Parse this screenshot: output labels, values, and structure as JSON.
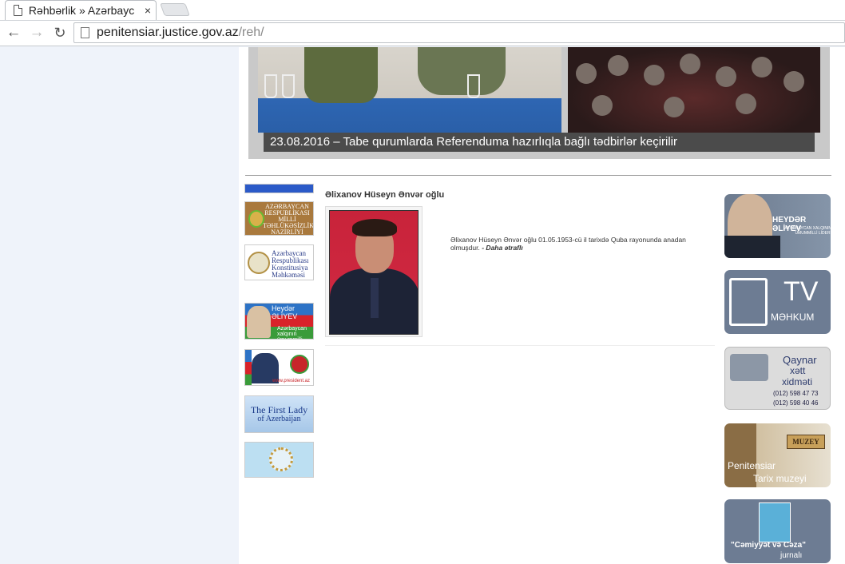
{
  "browser": {
    "tab_title": "Rəhbərlik » Azərbayc",
    "tab_close": "×",
    "url_host": "penitensiar.justice.gov.az",
    "url_path": "/reh/"
  },
  "slider": {
    "caption": "23.08.2016 – Tabe qurumlarda Referenduma hazırlıqla bağlı tədbirlər keçirilir"
  },
  "left_banners": {
    "mtn_text": "AZƏRBAYCAN RESPUBLİKASI MİLLİ TƏHLÜKƏSİZLİK NAZİRLİYİ",
    "kons_text": "Azərbaycan Respublikası Konstitusiya Məhkəməsi",
    "heydar_name": "Heydər ƏLİYEV",
    "heydar_sub": "Azərbaycan xalqının ümummilli lideri",
    "president_url": "www.president.az",
    "lady_title": "The First Lady",
    "lady_sub": "of Azerbaijan"
  },
  "person": {
    "name": "Əlixanov Hüseyn Ənvər oğlu",
    "bio": "Əlixanov Hüseyn Ənvər oğlu 01.05.1953-cü il tarixdə Quba rayonunda anadan olmuşdur.",
    "more": "- Daha ətraflı"
  },
  "right_banners": {
    "heydar_name": "HEYDƏR ƏLİYEV",
    "heydar_sub": "AZƏRBAYCAN XALQININ ÜMUMMİLLİ LİDERİ",
    "tv": "TV",
    "mehkum": "MƏHKUM",
    "hotline_1": "Qaynar",
    "hotline_2": "xətt",
    "hotline_3": "xidməti",
    "phone_1": "(012) 598 47 73",
    "phone_2": "(012) 598 40 46",
    "museum_sign": "MUZEY",
    "museum_1": "Penitensiar",
    "museum_2": "Tarix muzeyi",
    "journal_1": "\"Cəmiyyət və Cəza\"",
    "journal_2": "jurnalı"
  }
}
